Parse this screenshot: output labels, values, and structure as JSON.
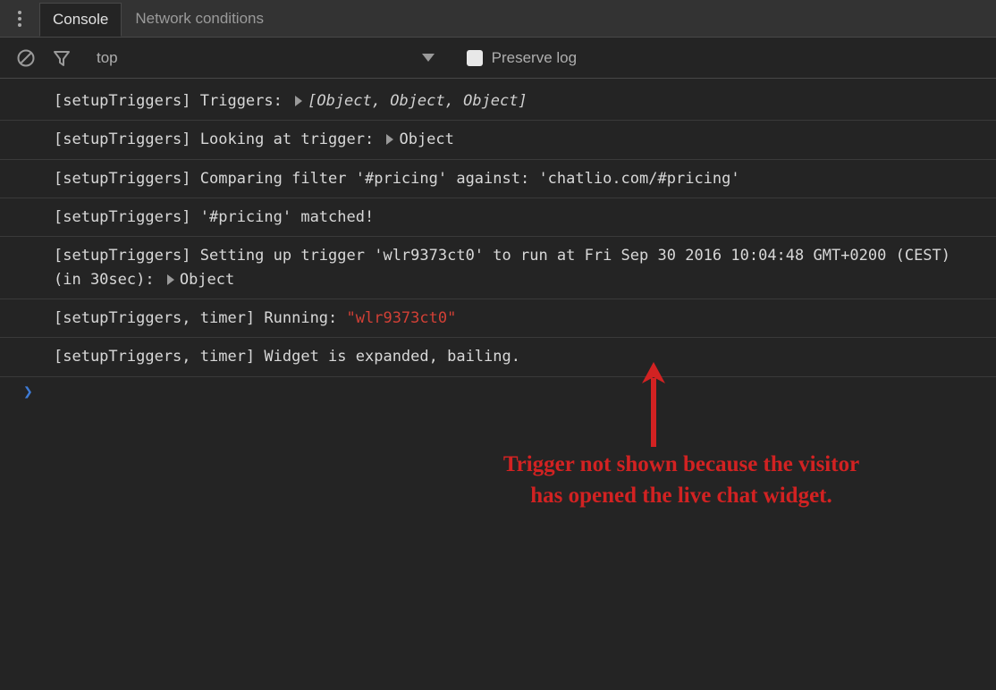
{
  "tabs": {
    "console": "Console",
    "network": "Network conditions"
  },
  "toolbar": {
    "context": "top",
    "preserve_label": "Preserve log"
  },
  "log": [
    {
      "prefix": "[setupTriggers] Triggers: ",
      "expander": true,
      "italic": "[Object, Object, Object]"
    },
    {
      "prefix": "[setupTriggers] Looking at trigger: ",
      "expander": true,
      "suffix": "Object"
    },
    {
      "prefix": "[setupTriggers] Comparing filter '#pricing' against: 'chatlio.com/#pricing'"
    },
    {
      "prefix": "[setupTriggers] '#pricing' matched!"
    },
    {
      "prefix": "[setupTriggers] Setting up trigger 'wlr9373ct0' to run at Fri Sep 30 2016 10:04:48 GMT+0200 (CEST) (in 30sec): ",
      "expander": true,
      "suffix": "Object"
    },
    {
      "prefix": "[setupTriggers, timer] Running: ",
      "red": "\"wlr9373ct0\""
    },
    {
      "prefix": "[setupTriggers, timer] Widget is expanded, bailing."
    }
  ],
  "prompt": "❯",
  "annotation": {
    "line1": "Trigger not shown because the  visitor",
    "line2": "has opened the live chat widget."
  }
}
